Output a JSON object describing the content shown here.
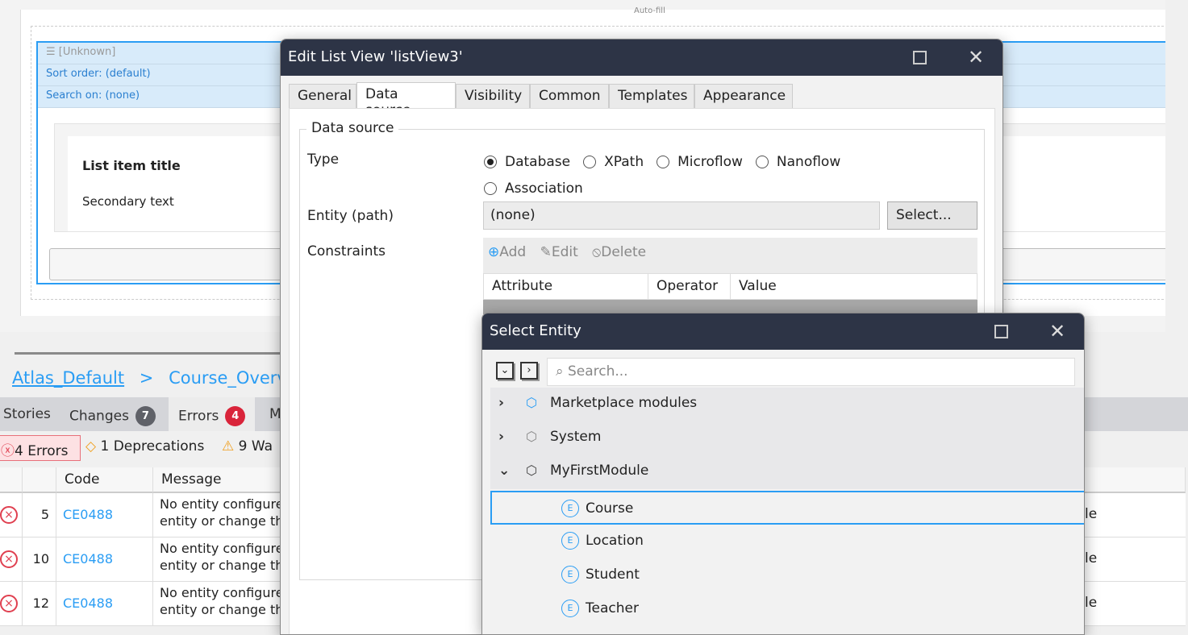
{
  "canvas": {
    "autofill": "Auto-fill",
    "listview": {
      "header": "[Unknown]",
      "sort": "Sort order: (default)",
      "search": "Search on: (none)",
      "item_title": "List item title",
      "item_secondary": "Secondary text"
    }
  },
  "breadcrumb": {
    "first": "Atlas_Default",
    "sep": ">",
    "second": "Course_Overview"
  },
  "bottom_tabs": [
    {
      "label": "Stories"
    },
    {
      "label": "Changes",
      "badge": "7"
    },
    {
      "label": "Errors",
      "badge": "4"
    },
    {
      "label": "M"
    }
  ],
  "filters": {
    "errors": "4 Errors",
    "deprecations": "1 Deprecations",
    "warnings": "9 Wa"
  },
  "error_table": {
    "headers": [
      "",
      "",
      "Code",
      "Message"
    ],
    "rows": [
      {
        "num": "5",
        "code": "CE0488",
        "msg1": "No entity configure",
        "msg2": "entity or change th",
        "tail": "le"
      },
      {
        "num": "10",
        "code": "CE0488",
        "msg1": "No entity configure",
        "msg2": "entity or change th",
        "tail": "le"
      },
      {
        "num": "12",
        "code": "CE0488",
        "msg1": "No entity configure",
        "msg2": "entity or change th",
        "tail": "le"
      }
    ]
  },
  "edit_dialog": {
    "title": "Edit List View 'listView3'",
    "tabs": [
      "General",
      "Data source",
      "Visibility",
      "Common",
      "Templates",
      "Appearance"
    ],
    "active_tab": "Data source",
    "group": "Data source",
    "type_label": "Type",
    "types": [
      "Database",
      "XPath",
      "Microflow",
      "Nanoflow",
      "Association"
    ],
    "selected_type": "Database",
    "entity_label": "Entity (path)",
    "entity_value": "(none)",
    "select_button": "Select...",
    "constraints_label": "Constraints",
    "toolbar": {
      "add": "Add",
      "edit": "Edit",
      "delete": "Delete"
    },
    "columns": [
      "Attribute",
      "Operator",
      "Value"
    ]
  },
  "select_entity": {
    "title": "Select Entity",
    "search_placeholder": "Search...",
    "modules": [
      {
        "name": "Marketplace modules",
        "expanded": false,
        "color": "#2a9df4"
      },
      {
        "name": "System",
        "expanded": false,
        "color": "#888888"
      },
      {
        "name": "MyFirstModule",
        "expanded": true,
        "color": "#444444"
      }
    ],
    "entities": [
      "Course",
      "Location",
      "Student",
      "Teacher"
    ],
    "selected": "Course"
  },
  "colors": {
    "accent": "#2a9df4",
    "titlebar": "#2d3446",
    "error": "#e04050"
  }
}
